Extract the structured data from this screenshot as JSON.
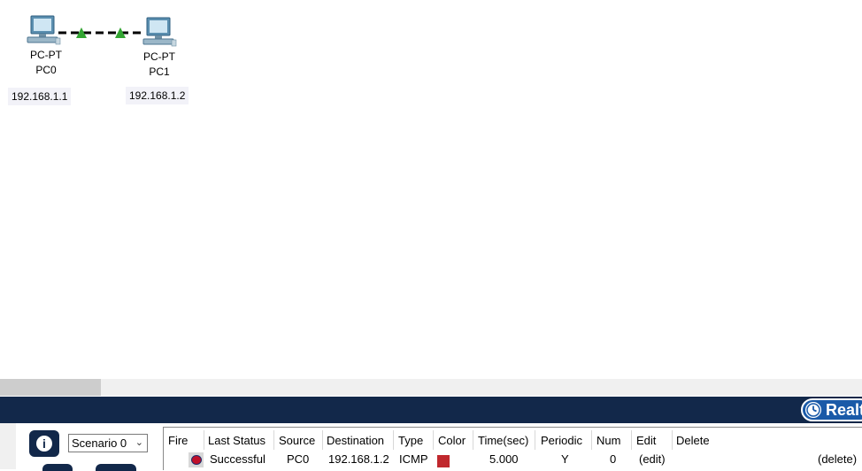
{
  "workspace": {
    "devices": [
      {
        "type_label": "PC-PT",
        "name": "PC0",
        "ip": "192.168.1.1"
      },
      {
        "type_label": "PC-PT",
        "name": "PC1",
        "ip": "192.168.1.2"
      }
    ],
    "link": {
      "status_color": "#33a532",
      "style": "dashed"
    }
  },
  "navbar": {
    "realtime_label": "Realt",
    "color": "#12284a"
  },
  "left_panel": {
    "info_icon": "i",
    "scenario_value": "Scenario 0"
  },
  "pdu_table": {
    "headers": [
      "Fire",
      "Last Status",
      "Source",
      "Destination",
      "Type",
      "Color",
      "Time(sec)",
      "Periodic",
      "Num",
      "Edit",
      "Delete"
    ],
    "rows": [
      {
        "fire_icon": "fire-indicator-icon",
        "last_status": "Successful",
        "source": "PC0",
        "destination": "192.168.1.2",
        "type": "ICMP",
        "color": "#c0282d",
        "time": "5.000",
        "periodic": "Y",
        "num": "0",
        "edit": "(edit)",
        "delete": "(delete)"
      }
    ]
  }
}
